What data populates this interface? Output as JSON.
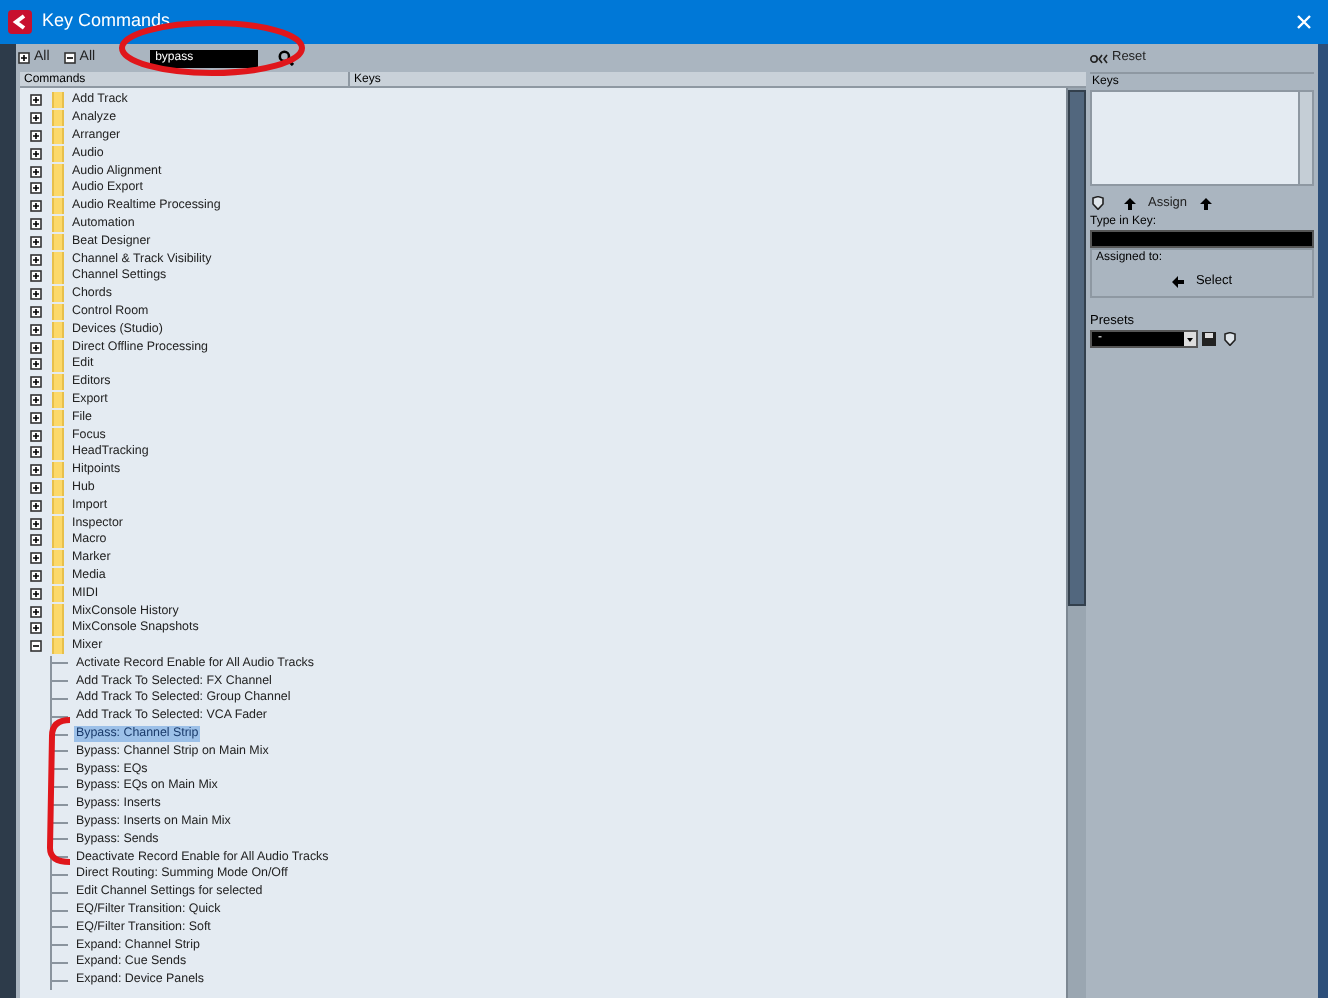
{
  "window": {
    "title": "Key Commands"
  },
  "toolbar": {
    "expand_all": "All",
    "collapse_all": "All",
    "search": {
      "value": "bypass"
    }
  },
  "columns": [
    "Commands",
    "Keys"
  ],
  "tree": [
    {
      "label": "Add Track",
      "expanded": false,
      "selected": false
    },
    {
      "label": "Analyze",
      "expanded": false,
      "selected": false
    },
    {
      "label": "Arranger",
      "expanded": false,
      "selected": false
    },
    {
      "label": "Audio",
      "expanded": false,
      "selected": false
    },
    {
      "label": "Audio Alignment",
      "expanded": false,
      "selected": false
    },
    {
      "label": "Audio Export",
      "expanded": false,
      "selected": false
    },
    {
      "label": "Audio Realtime Processing",
      "expanded": false,
      "selected": false
    },
    {
      "label": "Automation",
      "expanded": false,
      "selected": false
    },
    {
      "label": "Beat Designer",
      "expanded": false,
      "selected": false
    },
    {
      "label": "Channel & Track Visibility",
      "expanded": false,
      "selected": false
    },
    {
      "label": "Channel Settings",
      "expanded": false,
      "selected": false
    },
    {
      "label": "Chords",
      "expanded": false,
      "selected": false
    },
    {
      "label": "Control Room",
      "expanded": false,
      "selected": false
    },
    {
      "label": "Devices (Studio)",
      "expanded": false,
      "selected": false
    },
    {
      "label": "Direct Offline Processing",
      "expanded": false,
      "selected": false
    },
    {
      "label": "Edit",
      "expanded": false,
      "selected": false
    },
    {
      "label": "Editors",
      "expanded": false,
      "selected": false
    },
    {
      "label": "Export",
      "expanded": false,
      "selected": false
    },
    {
      "label": "File",
      "expanded": false,
      "selected": false
    },
    {
      "label": "Focus",
      "expanded": false,
      "selected": false
    },
    {
      "label": "HeadTracking",
      "expanded": false,
      "selected": false
    },
    {
      "label": "Hitpoints",
      "expanded": false,
      "selected": false
    },
    {
      "label": "Hub",
      "expanded": false,
      "selected": false
    },
    {
      "label": "Import",
      "expanded": false,
      "selected": false
    },
    {
      "label": "Inspector",
      "expanded": false,
      "selected": false
    },
    {
      "label": "Macro",
      "expanded": false,
      "selected": false
    },
    {
      "label": "Marker",
      "expanded": false,
      "selected": false
    },
    {
      "label": "Media",
      "expanded": false,
      "selected": false
    },
    {
      "label": "MIDI",
      "expanded": false,
      "selected": false
    },
    {
      "label": "MixConsole History",
      "expanded": false,
      "selected": false
    },
    {
      "label": "MixConsole Snapshots",
      "expanded": false,
      "selected": false
    },
    {
      "label": "Mixer",
      "expanded": true,
      "selected": false,
      "children": [
        {
          "label": "Activate Record Enable for All Audio Tracks",
          "selected": false
        },
        {
          "label": "Add Track To Selected: FX Channel",
          "selected": false
        },
        {
          "label": "Add Track To Selected: Group Channel",
          "selected": false
        },
        {
          "label": "Add Track To Selected: VCA Fader",
          "selected": false
        },
        {
          "label": "Bypass: Channel Strip",
          "selected": true
        },
        {
          "label": "Bypass: Channel Strip on Main Mix",
          "selected": false
        },
        {
          "label": "Bypass: EQs",
          "selected": false
        },
        {
          "label": "Bypass: EQs on Main Mix",
          "selected": false
        },
        {
          "label": "Bypass: Inserts",
          "selected": false
        },
        {
          "label": "Bypass: Inserts on Main Mix",
          "selected": false
        },
        {
          "label": "Bypass: Sends",
          "selected": false
        },
        {
          "label": "Deactivate Record Enable for All Audio Tracks",
          "selected": false
        },
        {
          "label": "Direct Routing: Summing Mode On/Off",
          "selected": false
        },
        {
          "label": "Edit Channel Settings for selected",
          "selected": false
        },
        {
          "label": "EQ/Filter Transition: Quick",
          "selected": false
        },
        {
          "label": "EQ/Filter Transition: Soft",
          "selected": false
        },
        {
          "label": "Expand: Channel Strip",
          "selected": false
        },
        {
          "label": "Expand: Cue Sends",
          "selected": false
        },
        {
          "label": "Expand: Device Panels",
          "selected": false
        }
      ]
    }
  ],
  "right_panel": {
    "reset": "Reset",
    "keys_heading": "Keys",
    "assign": "Assign",
    "type_in_key_label": "Type in Key:",
    "assigned_to_label": "Assigned to:",
    "select": "Select",
    "presets_label": "Presets",
    "preset_value": "-"
  }
}
